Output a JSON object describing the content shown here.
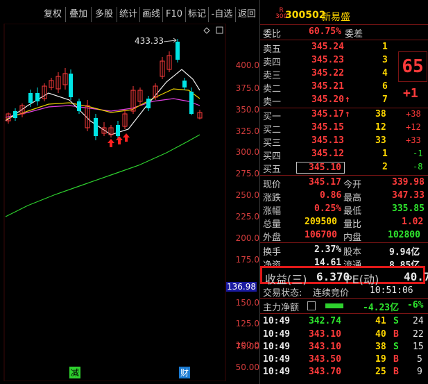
{
  "toolbar": [
    "复权",
    "叠加",
    "多股",
    "统计",
    "画线",
    "F10",
    "标记",
    "-自选",
    "返回"
  ],
  "chart": {
    "y_ticks": [
      "400.0",
      "375.0",
      "350.0",
      "325.0",
      "300.0",
      "275.0",
      "250.0",
      "225.0",
      "200.0",
      "175.0",
      "150.0",
      "125.0",
      "100.0",
      "75.00",
      "50.00"
    ],
    "high_label": "433.33",
    "current_marker": "136.98",
    "bottom_marks": [
      "减",
      "财"
    ]
  },
  "stock": {
    "badge_top": "R",
    "badge_bottom": "300",
    "code": "300502",
    "name": "新易盛"
  },
  "weibi": {
    "label": "委比",
    "value": "60.75%",
    "label2": "委差"
  },
  "asks": [
    {
      "label": "卖五",
      "price": "345.24",
      "vol": "1",
      "chg": ""
    },
    {
      "label": "卖四",
      "price": "345.23",
      "vol": "3",
      "chg": ""
    },
    {
      "label": "卖三",
      "price": "345.22",
      "vol": "4",
      "chg": ""
    },
    {
      "label": "卖二",
      "price": "345.21",
      "vol": "6",
      "chg": ""
    },
    {
      "label": "卖一",
      "price": "345.20",
      "vol": "7",
      "chg": "",
      "arrow": "↑"
    }
  ],
  "bids": [
    {
      "label": "买一",
      "price": "345.17",
      "vol": "38",
      "chg": "+38",
      "arrow": "↑"
    },
    {
      "label": "买二",
      "price": "345.15",
      "vol": "12",
      "chg": "+12"
    },
    {
      "label": "买三",
      "price": "345.13",
      "vol": "33",
      "chg": "+33"
    },
    {
      "label": "买四",
      "price": "345.12",
      "vol": "1",
      "chg": "-1"
    },
    {
      "label": "买五",
      "price": "345.10",
      "vol": "2",
      "chg": "-8"
    }
  ],
  "side_badges": {
    "big": "65",
    "small": "+1"
  },
  "stats": [
    {
      "l1": "现价",
      "v1": "345.17",
      "l2": "今开",
      "v2": "339.98"
    },
    {
      "l1": "涨跌",
      "v1": "0.86",
      "l2": "最高",
      "v2": "347.33"
    },
    {
      "l1": "涨幅",
      "v1": "0.25%",
      "l2": "最低",
      "v2": "335.85"
    },
    {
      "l1": "总量",
      "v1": "209500",
      "l2": "量比",
      "v2": "1.02"
    },
    {
      "l1": "外盘",
      "v1": "106700",
      "l2": "内盘",
      "v2": "102800"
    }
  ],
  "stats2": [
    {
      "l1": "换手",
      "v1": "2.37%",
      "l2": "股本",
      "v2": "9.94亿"
    },
    {
      "l1": "净资",
      "v1": "14.61",
      "l2": "流通",
      "v2": "8.85亿"
    }
  ],
  "earnings": {
    "label": "收益(三)",
    "value": "6.370",
    "pe_label": "PE(动)",
    "pe": "40.7"
  },
  "trade_status": {
    "label": "交易状态:",
    "value": "连续竞价",
    "time": "10:51:06"
  },
  "capital": {
    "label": "主力净额",
    "value": "-4.23亿",
    "pct": "-6%"
  },
  "ticks": [
    {
      "time": "10:49",
      "price": "342.74",
      "vol": "41",
      "side": "S",
      "n": "24"
    },
    {
      "time": "10:49",
      "price": "343.10",
      "vol": "40",
      "side": "B",
      "n": "22"
    },
    {
      "time": "10:49",
      "price": "343.10",
      "vol": "38",
      "side": "S",
      "n": "15"
    },
    {
      "time": "10:49",
      "price": "343.50",
      "vol": "19",
      "side": "B",
      "n": "5"
    },
    {
      "time": "10:49",
      "price": "343.70",
      "vol": "25",
      "side": "B",
      "n": "9"
    }
  ]
}
